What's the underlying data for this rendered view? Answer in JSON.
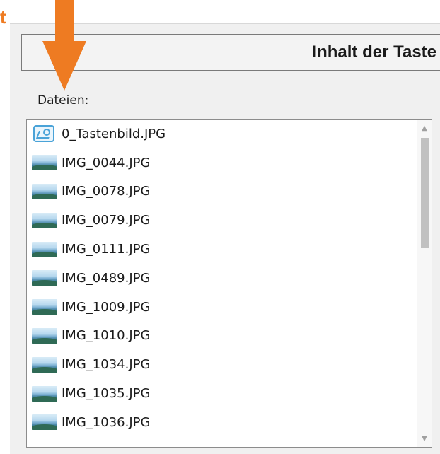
{
  "corner_text": "t",
  "header": {
    "title": "Inhalt der Taste"
  },
  "files": {
    "label": "Dateien:",
    "items": [
      {
        "name": "0_Tastenbild.JPG",
        "icon": "picture-file-icon"
      },
      {
        "name": "IMG_0044.JPG",
        "icon": "image-thumbnail-icon"
      },
      {
        "name": "IMG_0078.JPG",
        "icon": "image-thumbnail-icon"
      },
      {
        "name": "IMG_0079.JPG",
        "icon": "image-thumbnail-icon"
      },
      {
        "name": "IMG_0111.JPG",
        "icon": "image-thumbnail-icon"
      },
      {
        "name": "IMG_0489.JPG",
        "icon": "image-thumbnail-icon"
      },
      {
        "name": "IMG_1009.JPG",
        "icon": "image-thumbnail-icon"
      },
      {
        "name": "IMG_1010.JPG",
        "icon": "image-thumbnail-icon"
      },
      {
        "name": "IMG_1034.JPG",
        "icon": "image-thumbnail-icon"
      },
      {
        "name": "IMG_1035.JPG",
        "icon": "image-thumbnail-icon"
      },
      {
        "name": "IMG_1036.JPG",
        "icon": "image-thumbnail-icon"
      }
    ]
  },
  "colors": {
    "accent_arrow": "#ee7b22",
    "icon_blue": "#4aa3d8"
  }
}
